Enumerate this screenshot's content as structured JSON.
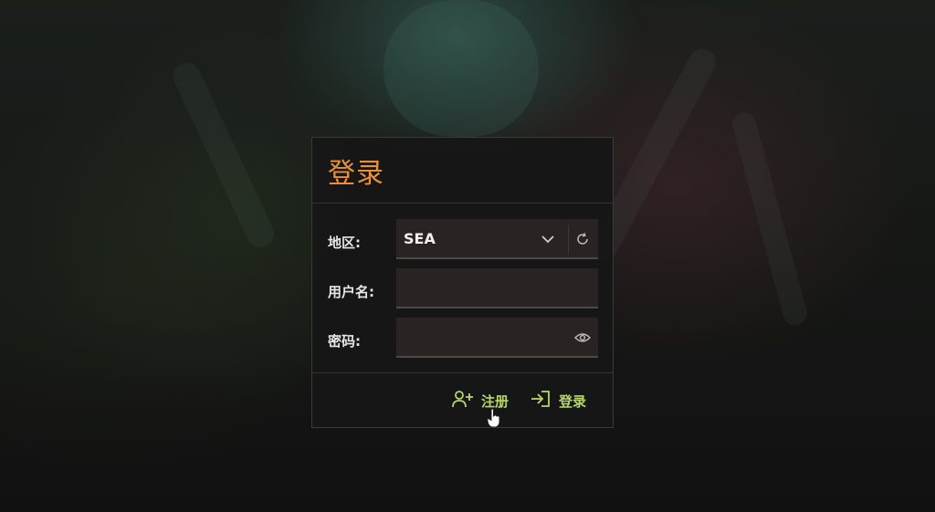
{
  "dialog": {
    "title": "登录",
    "region": {
      "label": "地区:",
      "value": "SEA",
      "dropdown_icon": "chevron-down-icon",
      "reset_icon": "refresh-icon"
    },
    "username": {
      "label": "用户名:",
      "value": ""
    },
    "password": {
      "label": "密码:",
      "value": "",
      "toggle_icon": "eye-icon"
    },
    "actions": {
      "register_label": "注册",
      "register_icon": "add-user-icon",
      "login_label": "登录",
      "login_icon": "login-icon"
    }
  },
  "colors": {
    "title": "#e8903a",
    "action": "#b5d66b",
    "field_bg": "#2a2323",
    "dialog_bg": "#161616"
  }
}
